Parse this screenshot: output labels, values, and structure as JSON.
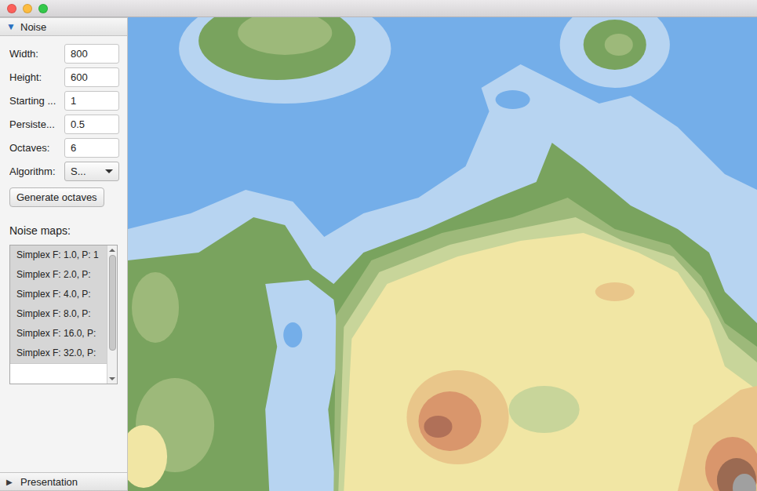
{
  "window": {
    "controls": [
      {
        "name": "close",
        "color": "#fc605b"
      },
      {
        "name": "minimize",
        "color": "#fdbc40"
      },
      {
        "name": "zoom",
        "color": "#34c84a"
      }
    ]
  },
  "sidebar": {
    "panels": [
      {
        "title": "Noise",
        "icon": "▼",
        "expanded": true
      },
      {
        "title": "Presentation",
        "icon": "▶",
        "expanded": false
      }
    ],
    "fields": [
      {
        "label": "Width:",
        "value": "800",
        "kind": "text"
      },
      {
        "label": "Height:",
        "value": "600",
        "kind": "text"
      },
      {
        "label": "Starting ...",
        "value": "1",
        "kind": "text"
      },
      {
        "label": "Persiste...",
        "value": "0.5",
        "kind": "text"
      },
      {
        "label": "Octaves:",
        "value": "6",
        "kind": "text"
      },
      {
        "label": "Algorithm:",
        "value": "S...",
        "kind": "combo"
      }
    ],
    "button": "Generate octaves",
    "list_label": "Noise maps:",
    "noise_maps": [
      {
        "label": "Simplex F: 1.0, P: 1"
      },
      {
        "label": "Simplex F: 2.0, P:"
      },
      {
        "label": "Simplex F: 4.0, P:"
      },
      {
        "label": "Simplex F: 8.0, P:"
      },
      {
        "label": "Simplex F: 16.0, P:"
      },
      {
        "label": "Simplex F: 32.0, P:"
      }
    ]
  }
}
